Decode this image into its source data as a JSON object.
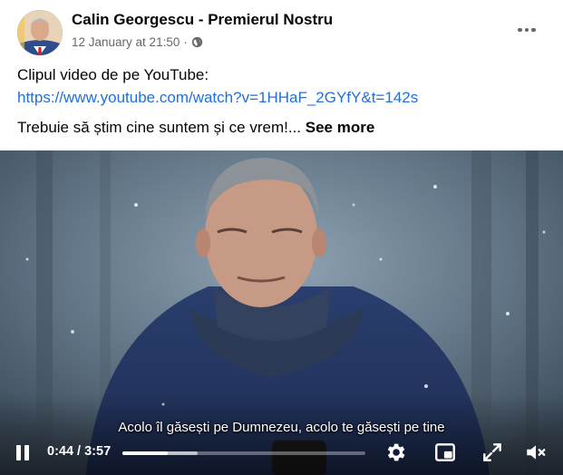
{
  "post": {
    "author": "Calin Georgescu - Premierul Nostru",
    "timestamp": "12 January at 21:50",
    "separator": "·",
    "privacy_icon": "globe-icon",
    "more_icon": "more-options-icon",
    "text_intro": "Clipul video de pe YouTube:",
    "link": "https://www.youtube.com/watch?v=1HHaF_2GYfY&t=142s",
    "text_truncated": "Trebuie să știm cine suntem și ce vrem!...",
    "see_more": "See more"
  },
  "video": {
    "subtitle": "Acolo îl găsești pe Dumnezeu, acolo te găsești pe tine",
    "current_time": "0:44",
    "duration": "3:57",
    "time_display": "0:44 / 3:57",
    "progress_fraction": 0.186,
    "buffered_fraction": 0.31,
    "icons": [
      "pause-icon",
      "settings-icon",
      "picture-in-picture-icon",
      "fullscreen-icon",
      "mute-icon"
    ]
  },
  "colors": {
    "link": "#216fdb",
    "secondary_text": "#65676b",
    "primary_text": "#050505"
  }
}
